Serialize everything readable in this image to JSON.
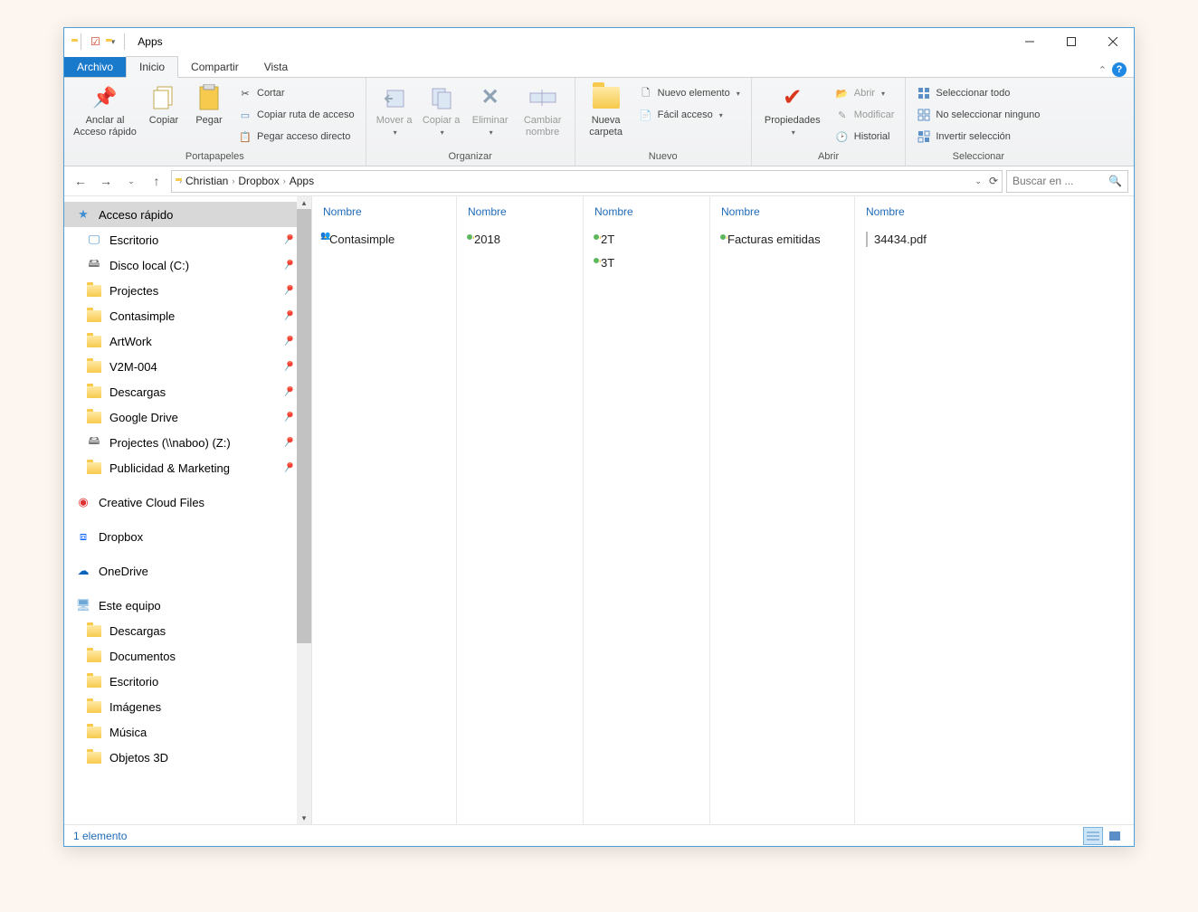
{
  "title": "Apps",
  "tabs": {
    "file": "Archivo",
    "home": "Inicio",
    "share": "Compartir",
    "view": "Vista"
  },
  "ribbon": {
    "clipboard": {
      "label": "Portapapeles",
      "pin": "Anclar al Acceso rápido",
      "copy": "Copiar",
      "paste": "Pegar",
      "cut": "Cortar",
      "copy_path": "Copiar ruta de acceso",
      "paste_shortcut": "Pegar acceso directo"
    },
    "organize": {
      "label": "Organizar",
      "move": "Mover a",
      "copy_to": "Copiar a",
      "delete": "Eliminar",
      "rename": "Cambiar nombre"
    },
    "new": {
      "label": "Nuevo",
      "new_folder": "Nueva carpeta",
      "new_item": "Nuevo elemento",
      "easy_access": "Fácil acceso"
    },
    "open": {
      "label": "Abrir",
      "properties": "Propiedades",
      "open": "Abrir",
      "edit": "Modificar",
      "history": "Historial"
    },
    "select": {
      "label": "Seleccionar",
      "all": "Seleccionar todo",
      "none": "No seleccionar ninguno",
      "invert": "Invertir selección"
    }
  },
  "breadcrumb": [
    "Christian",
    "Dropbox",
    "Apps"
  ],
  "search_placeholder": "Buscar en ...",
  "nav": {
    "quick": {
      "label": "Acceso rápido",
      "items": [
        {
          "label": "Escritorio"
        },
        {
          "label": "Disco local (C:)"
        },
        {
          "label": "Projectes"
        },
        {
          "label": "Contasimple"
        },
        {
          "label": "ArtWork"
        },
        {
          "label": "V2M-004"
        },
        {
          "label": "Descargas"
        },
        {
          "label": "Google Drive"
        },
        {
          "label": "Projectes (\\\\naboo) (Z:)"
        },
        {
          "label": "Publicidad & Marketing"
        }
      ]
    },
    "creative": "Creative Cloud Files",
    "dropbox": "Dropbox",
    "onedrive": "OneDrive",
    "pc": {
      "label": "Este equipo",
      "items": [
        {
          "label": "Descargas"
        },
        {
          "label": "Documentos"
        },
        {
          "label": "Escritorio"
        },
        {
          "label": "Imágenes"
        },
        {
          "label": "Música"
        },
        {
          "label": "Objetos 3D"
        }
      ]
    }
  },
  "columns_header": "Nombre",
  "cols": [
    [
      {
        "label": "Contasimple",
        "type": "folder-people"
      }
    ],
    [
      {
        "label": "2018",
        "type": "folder"
      }
    ],
    [
      {
        "label": "2T",
        "type": "folder"
      },
      {
        "label": "3T",
        "type": "folder"
      }
    ],
    [
      {
        "label": "Facturas emitidas",
        "type": "folder"
      }
    ],
    [
      {
        "label": "34434.pdf",
        "type": "pdf"
      }
    ]
  ],
  "status": "1 elemento"
}
